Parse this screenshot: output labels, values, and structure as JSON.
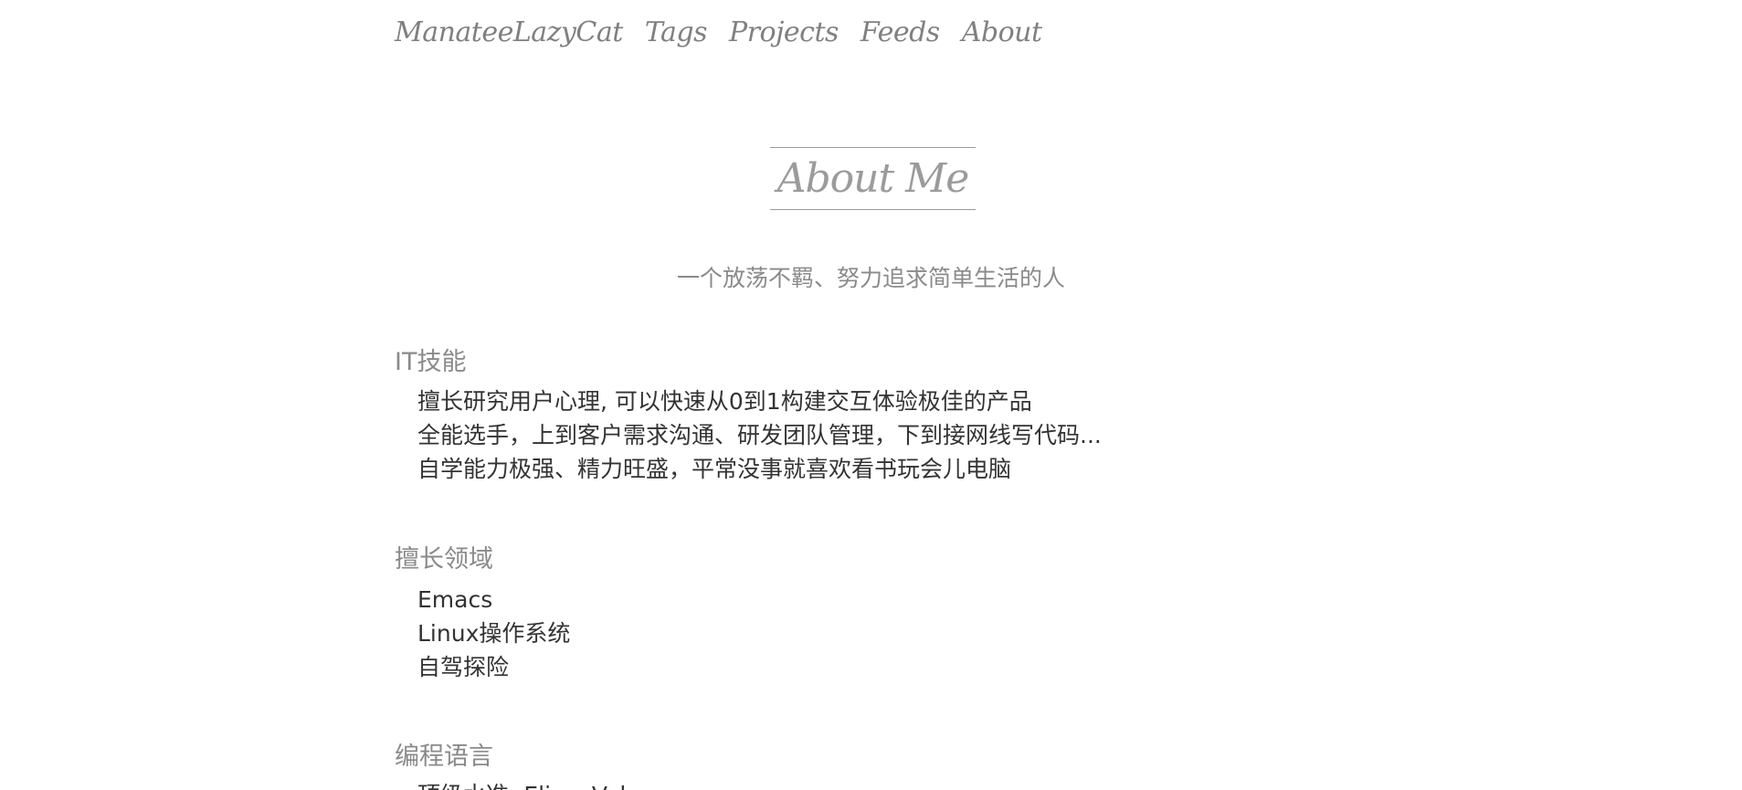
{
  "nav": {
    "brand": "ManateeLazyCat",
    "items": [
      {
        "label": "Tags"
      },
      {
        "label": "Projects"
      },
      {
        "label": "Feeds"
      },
      {
        "label": "About"
      }
    ]
  },
  "page": {
    "title": "About Me",
    "subtitle": "一个放荡不羁、努力追求简单生活的人"
  },
  "sections": [
    {
      "heading": "IT技能",
      "items": [
        "擅长研究用户心理, 可以快速从0到1构建交互体验极佳的产品",
        "全能选手，上到客户需求沟通、研发团队管理，下到接网线写代码...",
        "自学能力极强、精力旺盛，平常没事就喜欢看书玩会儿电脑"
      ]
    },
    {
      "heading": "擅长领域",
      "items": [
        "Emacs",
        "Linux操作系统",
        "自驾探险"
      ]
    },
    {
      "heading": "编程语言",
      "items": [
        "顶级水准: Elisp, Vala"
      ]
    }
  ]
}
